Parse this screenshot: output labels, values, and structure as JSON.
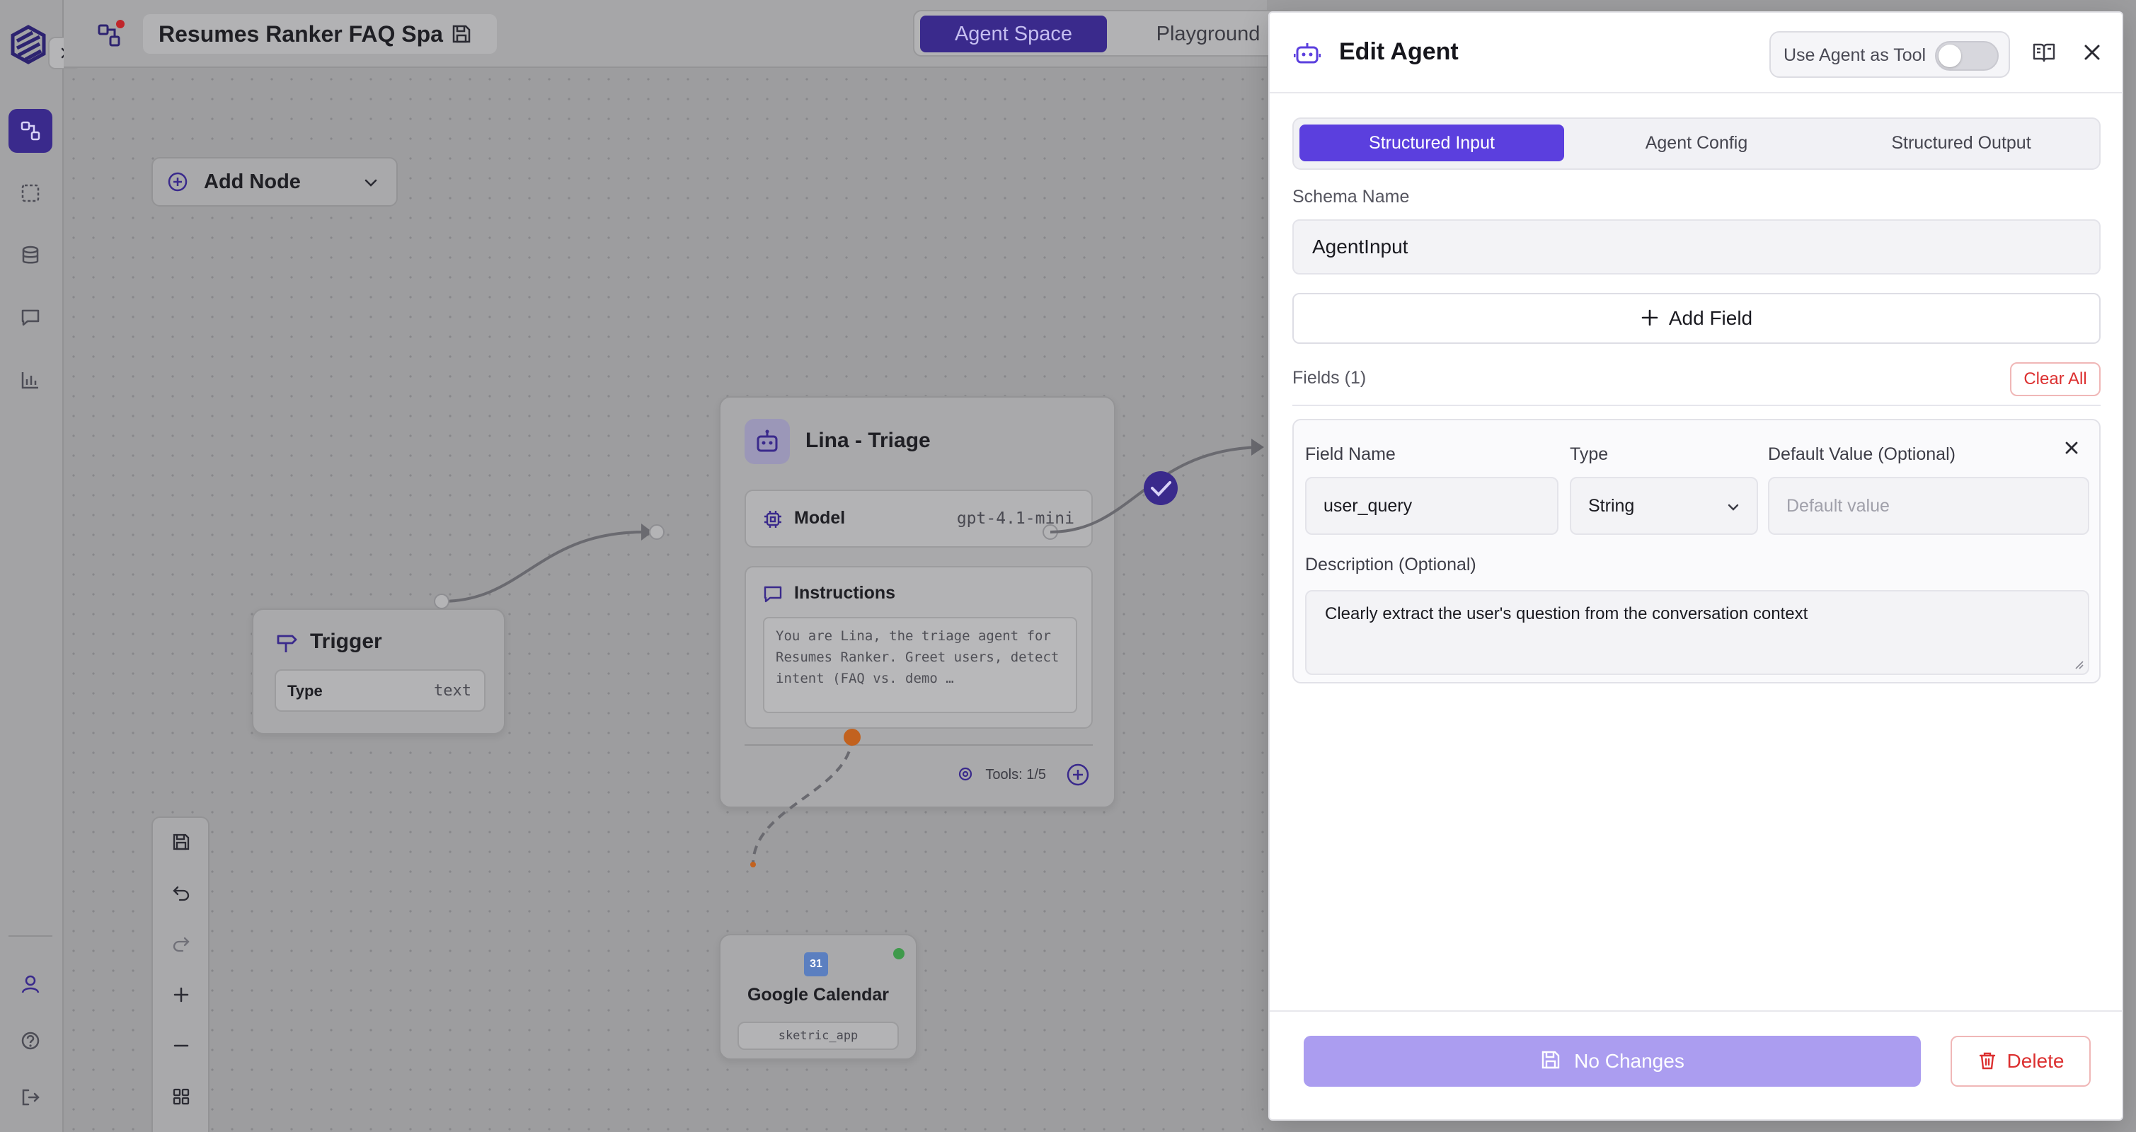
{
  "app": {
    "project_title": "Resumes Ranker FAQ Spa",
    "tabs": [
      {
        "label": "Agent Space",
        "active": true
      },
      {
        "label": "Playground",
        "active": false
      }
    ]
  },
  "canvas": {
    "add_node_label": "Add Node",
    "trigger_node": {
      "title": "Trigger",
      "row_key": "Type",
      "row_value": "text"
    },
    "agent_node": {
      "title": "Lina - Triage",
      "model_key": "Model",
      "model_value": "gpt-4.1-mini",
      "instructions_key": "Instructions",
      "instructions_text": "You are Lina, the triage agent for Resumes Ranker. Greet users, detect intent (FAQ vs. demo …",
      "tools_label": "Tools: 1/5"
    },
    "gcal_node": {
      "icon_text": "31",
      "title": "Google Calendar",
      "chip": "sketric_app"
    }
  },
  "panel": {
    "title": "Edit Agent",
    "use_as_tool_label": "Use Agent as Tool",
    "use_as_tool_on": false,
    "tabs": [
      {
        "label": "Structured Input",
        "active": true
      },
      {
        "label": "Agent Config",
        "active": false
      },
      {
        "label": "Structured Output",
        "active": false
      }
    ],
    "schema_name_label": "Schema Name",
    "schema_name_value": "AgentInput",
    "add_field_label": "Add Field",
    "fields_count_label": "Fields (1)",
    "clear_all_label": "Clear All",
    "field": {
      "name_label": "Field Name",
      "name_value": "user_query",
      "type_label": "Type",
      "type_value": "String",
      "default_label": "Default Value (Optional)",
      "default_placeholder": "Default value",
      "description_label": "Description (Optional)",
      "description_value": "Clearly extract the user's question from the conversation context"
    },
    "footer": {
      "no_changes_label": "No Changes",
      "delete_label": "Delete"
    }
  },
  "colors": {
    "accent": "#5b3fde",
    "accent_disabled": "#ab9df0",
    "danger": "#dc3030",
    "connection_orange": "#c2621f",
    "status_green": "#3f9a4b"
  }
}
